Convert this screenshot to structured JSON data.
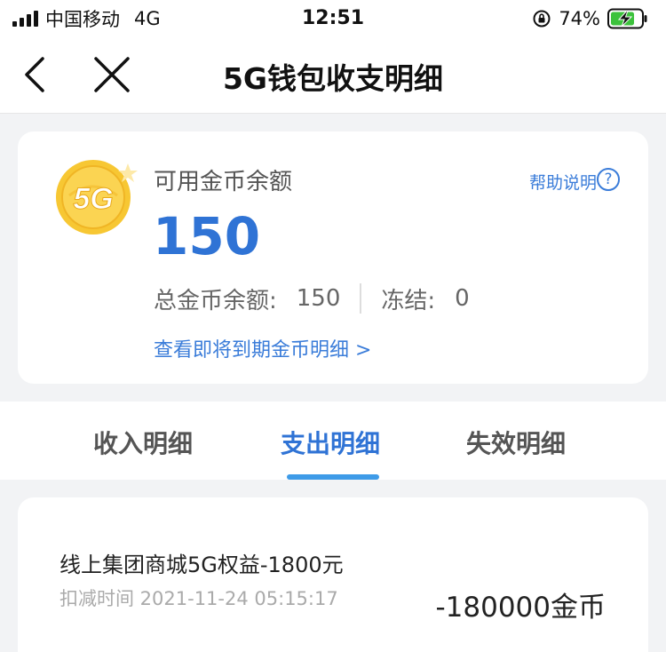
{
  "status_bar": {
    "carrier": "中国移动",
    "network": "4G",
    "time": "12:51",
    "battery_percent": "74%",
    "icons": [
      "signal-icon",
      "rotation-lock-icon",
      "battery-charging-icon"
    ]
  },
  "nav": {
    "title": "5G钱包收支明细",
    "icons": [
      "back-icon",
      "close-icon"
    ]
  },
  "balance": {
    "coin_badge": "5G",
    "available_label": "可用金币余额",
    "help_label": "帮助说明",
    "help_icon_glyph": "?",
    "available_value": "150",
    "total_label": "总金币余额:",
    "total_value": "150",
    "frozen_label": "冻结:",
    "frozen_value": "0",
    "expire_link": "查看即将到期金币明细 >"
  },
  "tabs": [
    {
      "label": "收入明细",
      "active": false
    },
    {
      "label": "支出明细",
      "active": true
    },
    {
      "label": "失效明细",
      "active": false
    }
  ],
  "records": [
    {
      "title": "线上集团商城5G权益-1800元",
      "time": "扣减时间 2021-11-24 05:15:17",
      "amount": "-180000金币"
    }
  ],
  "colors": {
    "accent": "#2f73d5",
    "link": "#3a7cd9",
    "tab_underline": "#3e9be8",
    "battery": "#3cc23c",
    "coin": "#f5c02c"
  }
}
